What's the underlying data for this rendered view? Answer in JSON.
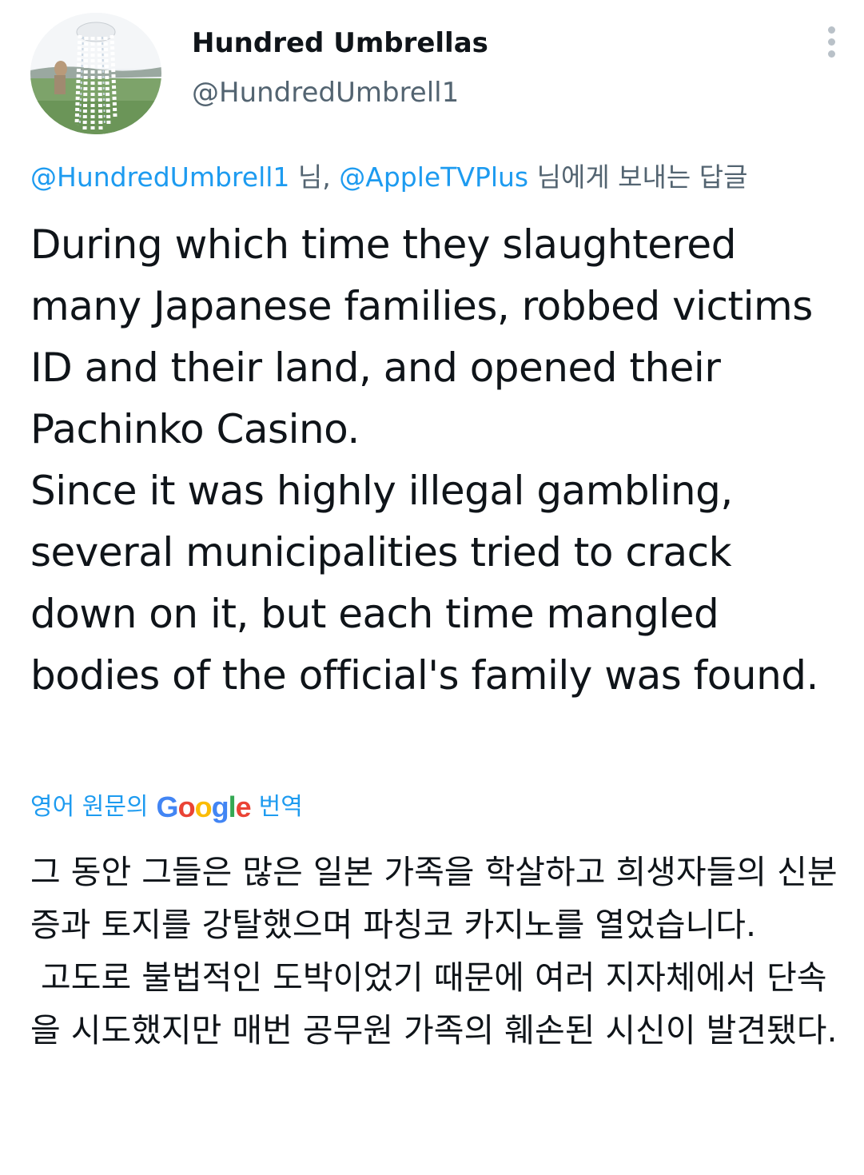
{
  "author": {
    "display_name": "Hundred Umbrellas",
    "handle": "@HundredUmbrell1"
  },
  "reply_context": {
    "mention_1": "@HundredUmbrell1",
    "between": " 님, ",
    "mention_2": "@AppleTVPlus",
    "suffix": " 님에게 보내는 답글"
  },
  "tweet": {
    "paragraphs": [
      "During which time they slaughtered many Japanese families, robbed victims ID and their land, and opened their Pachinko Casino.",
      "Since it was highly illegal gambling, several municipalities tried to crack down on it, but each time mangled bodies of the official's family was found."
    ]
  },
  "translation": {
    "prefix": "영어 원문의",
    "provider": "Google",
    "suffix": "번역",
    "paragraphs": [
      "그 동안 그들은 많은 일본 가족을 학살하고 희생자들의 신분증과 토지를 강탈했으며 파칭코 카지노를 열었습니다.",
      " 고도로 불법적인 도박이었기 때문에 여러 지자체에서 단속을 시도했지만 매번 공무원 가족의 훼손된 시신이 발견됐다."
    ]
  },
  "icons": {
    "more": "more-vertical-icon",
    "avatar": "profile-photo"
  },
  "colors": {
    "link": "#1d9bf0",
    "secondary_text": "#536471",
    "primary_text": "#0f1419"
  }
}
